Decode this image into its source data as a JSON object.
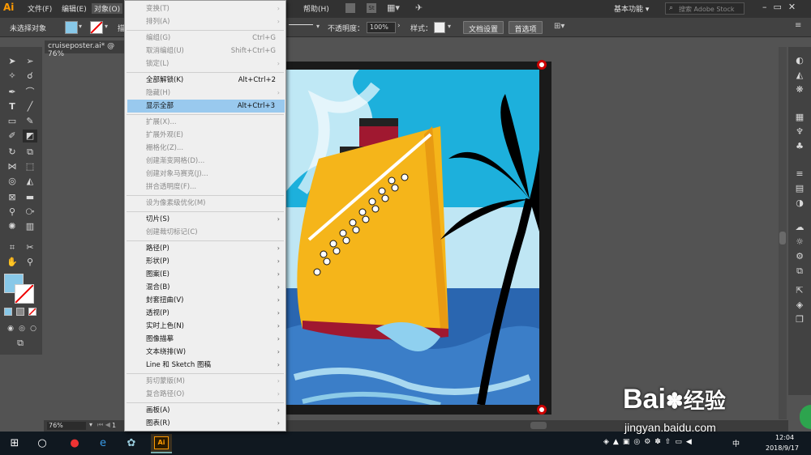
{
  "app": {
    "logo": "Ai"
  },
  "menubar": {
    "items": [
      "文件(F)",
      "编辑(E)",
      "对象(O)"
    ],
    "help": "帮助(H)",
    "workspace": "基本功能 ▾",
    "search_placeholder": "搜索 Adobe Stock"
  },
  "control": {
    "selection": "未选择对象",
    "opacity_label": "不透明度：",
    "opacity_value": "100%",
    "style_label": "样式：",
    "doc_setup": "文档设置",
    "prefs": "首选项",
    "stroke_partial": "描"
  },
  "doc": {
    "tab": "cruiseposter.ai* @ 76%"
  },
  "status": {
    "zoom": "76%",
    "page": "1"
  },
  "menu": {
    "items": [
      {
        "label": "变换(T)",
        "shortcut": "",
        "sub": true,
        "enabled": false
      },
      {
        "label": "排列(A)",
        "shortcut": "",
        "sub": true,
        "enabled": false
      },
      {
        "label": "编组(G)",
        "shortcut": "Ctrl+G",
        "sub": false,
        "enabled": false
      },
      {
        "label": "取消编组(U)",
        "shortcut": "Shift+Ctrl+G",
        "sub": false,
        "enabled": false
      },
      {
        "label": "锁定(L)",
        "shortcut": "",
        "sub": true,
        "enabled": false
      },
      {
        "label": "全部解锁(K)",
        "shortcut": "Alt+Ctrl+2",
        "sub": false,
        "enabled": true
      },
      {
        "label": "隐藏(H)",
        "shortcut": "",
        "sub": true,
        "enabled": false
      },
      {
        "label": "显示全部",
        "shortcut": "Alt+Ctrl+3",
        "sub": false,
        "enabled": true,
        "highlight": true
      },
      {
        "label": "扩展(X)...",
        "shortcut": "",
        "sub": false,
        "enabled": false
      },
      {
        "label": "扩展外观(E)",
        "shortcut": "",
        "sub": false,
        "enabled": false
      },
      {
        "label": "栅格化(Z)...",
        "shortcut": "",
        "sub": false,
        "enabled": false
      },
      {
        "label": "创建渐变网格(D)...",
        "shortcut": "",
        "sub": false,
        "enabled": false
      },
      {
        "label": "创建对象马赛克(J)...",
        "shortcut": "",
        "sub": false,
        "enabled": false
      },
      {
        "label": "拼合透明度(F)...",
        "shortcut": "",
        "sub": false,
        "enabled": false
      },
      {
        "label": "设为像素级优化(M)",
        "shortcut": "",
        "sub": false,
        "enabled": false
      },
      {
        "label": "切片(S)",
        "shortcut": "",
        "sub": true,
        "enabled": true
      },
      {
        "label": "创建裁切标记(C)",
        "shortcut": "",
        "sub": false,
        "enabled": false
      },
      {
        "label": "路径(P)",
        "shortcut": "",
        "sub": true,
        "enabled": true
      },
      {
        "label": "形状(P)",
        "shortcut": "",
        "sub": true,
        "enabled": true
      },
      {
        "label": "图案(E)",
        "shortcut": "",
        "sub": true,
        "enabled": true
      },
      {
        "label": "混合(B)",
        "shortcut": "",
        "sub": true,
        "enabled": true
      },
      {
        "label": "封套扭曲(V)",
        "shortcut": "",
        "sub": true,
        "enabled": true
      },
      {
        "label": "透视(P)",
        "shortcut": "",
        "sub": true,
        "enabled": true
      },
      {
        "label": "实时上色(N)",
        "shortcut": "",
        "sub": true,
        "enabled": true
      },
      {
        "label": "图像描摹",
        "shortcut": "",
        "sub": true,
        "enabled": true
      },
      {
        "label": "文本绕排(W)",
        "shortcut": "",
        "sub": true,
        "enabled": true
      },
      {
        "label": "Line 和 Sketch 图稿",
        "shortcut": "",
        "sub": true,
        "enabled": true
      },
      {
        "label": "剪切蒙版(M)",
        "shortcut": "",
        "sub": true,
        "enabled": false
      },
      {
        "label": "复合路径(O)",
        "shortcut": "",
        "sub": true,
        "enabled": false
      },
      {
        "label": "画板(A)",
        "shortcut": "",
        "sub": true,
        "enabled": true
      },
      {
        "label": "图表(R)",
        "shortcut": "",
        "sub": true,
        "enabled": true
      }
    ]
  },
  "taskbar": {
    "time": "12:04",
    "date": "2018/9/17",
    "ime": "中"
  },
  "watermark": {
    "brand": "Bai",
    "brand2": "经验",
    "url": "jingyan.baidu.com"
  },
  "colors": {
    "highlight": "#99c9ee",
    "menubg": "#efefef",
    "accent": "#ff9a00"
  }
}
